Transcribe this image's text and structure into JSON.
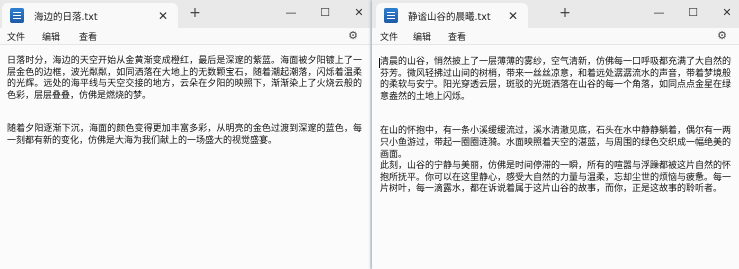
{
  "left_window": {
    "tab_title": "海边的日落.txt",
    "tab_close": "✕",
    "new_tab": "+",
    "menu": {
      "file": "文件",
      "edit": "编辑",
      "view": "查看"
    },
    "controls": {
      "minimize": "—",
      "maximize": "☐",
      "close": "✕"
    },
    "settings_icon": "⚙",
    "paragraphs": [
      "日落时分，海边的天空开始从金黄渐变成橙红，最后是深邃的紫蓝。海面被夕阳镀上了一层金色的边框，波光粼粼，如同洒落在大地上的无数颗宝石，随着潮起潮落，闪烁着温柔的光辉。远处的海平线与天空交接的地方，云朵在夕阳的映照下，渐渐染上了火烧云般的色彩，层层叠叠，仿佛是燃烧的梦。",
      "随着夕阳逐渐下沉，海面的颜色变得更加丰富多彩，从明亮的金色过渡到深邃的蓝色，每一刻都有新的变化，仿佛是大海为我们献上的一场盛大的视觉盛宴。"
    ]
  },
  "right_window": {
    "tab_title": "静谧山谷的晨曦.txt",
    "tab_close": "✕",
    "new_tab": "+",
    "menu": {
      "file": "文件",
      "edit": "编辑",
      "view": "查看"
    },
    "controls": {
      "minimize": "—",
      "maximize": "☐",
      "close": "✕"
    },
    "settings_icon": "⚙",
    "paragraphs": [
      "清晨的山谷，悄然披上了一层薄薄的雾纱，空气清新，仿佛每一口呼吸都充满了大自然的芬芳。微风轻拂过山间的树梢，带来一丝丝凉意，和着远处潺潺流水的声音，带着梦境般的柔软与安宁。阳光穿透云层，斑驳的光斑洒落在山谷的每一个角落，如同点点金星在绿意盎然的土地上闪烁。",
      "在山的怀抱中，有一条小溪缓缓流过，溪水清澈见底，石头在水中静静躺着，偶尔有一两只小鱼游过，带起一圈圈涟漪。水面映照着天空的湛蓝，与周围的绿色交织成一幅绝美的画面。\n此刻，山谷的宁静与美丽，仿佛是时间停滞的一瞬，所有的喧嚣与浮躁都被这片自然的怀抱所抚平。你可以在这里静心，感受大自然的力量与温柔，忘却尘世的烦恼与疲惫。每一片树叶，每一滴露水，都在诉说着属于这片山谷的故事，而你，正是这故事的聆听者。"
    ]
  }
}
